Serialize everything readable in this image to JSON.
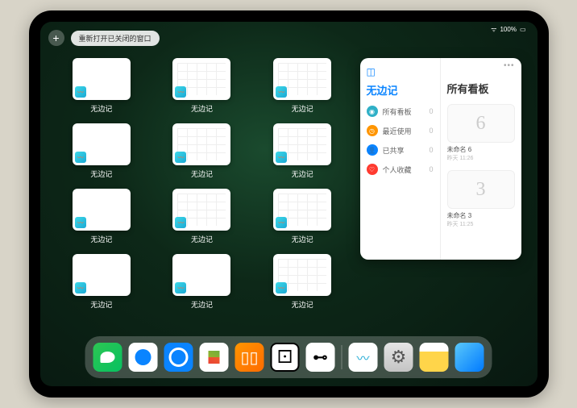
{
  "status": {
    "wifi": "⋮⋮",
    "battery": "100%"
  },
  "topbar": {
    "plus": "+",
    "reopen_label": "重新打开已关闭的窗口"
  },
  "thumbnails": {
    "app_label": "无边记",
    "items": [
      {
        "style": "blank"
      },
      {
        "style": "grid"
      },
      {
        "style": "grid"
      },
      {
        "style": "blank"
      },
      {
        "style": "grid"
      },
      {
        "style": "grid"
      },
      {
        "style": "blank"
      },
      {
        "style": "grid"
      },
      {
        "style": "grid"
      },
      {
        "style": "blank"
      },
      {
        "style": "blank"
      },
      {
        "style": "grid"
      }
    ]
  },
  "panel": {
    "left_title": "无边记",
    "right_title": "所有看板",
    "categories": [
      {
        "label": "所有看板",
        "count": "0",
        "color": "#30b0c7"
      },
      {
        "label": "最近使用",
        "count": "0",
        "color": "#ff9500"
      },
      {
        "label": "已共享",
        "count": "0",
        "color": "#0a84ff"
      },
      {
        "label": "个人收藏",
        "count": "0",
        "color": "#ff3b30"
      }
    ],
    "boards": [
      {
        "glyph": "6",
        "name": "未命名 6",
        "date": "昨天 11:26"
      },
      {
        "glyph": "3",
        "name": "未命名 3",
        "date": "昨天 11:25"
      }
    ]
  },
  "dock": {
    "apps": [
      {
        "name": "wechat"
      },
      {
        "name": "qq-browser-1"
      },
      {
        "name": "qq-browser-2"
      },
      {
        "name": "play-store"
      },
      {
        "name": "books"
      },
      {
        "name": "dice-app"
      },
      {
        "name": "connect-app"
      },
      {
        "name": "freeform"
      },
      {
        "name": "settings"
      },
      {
        "name": "notes"
      },
      {
        "name": "app-library"
      }
    ]
  }
}
